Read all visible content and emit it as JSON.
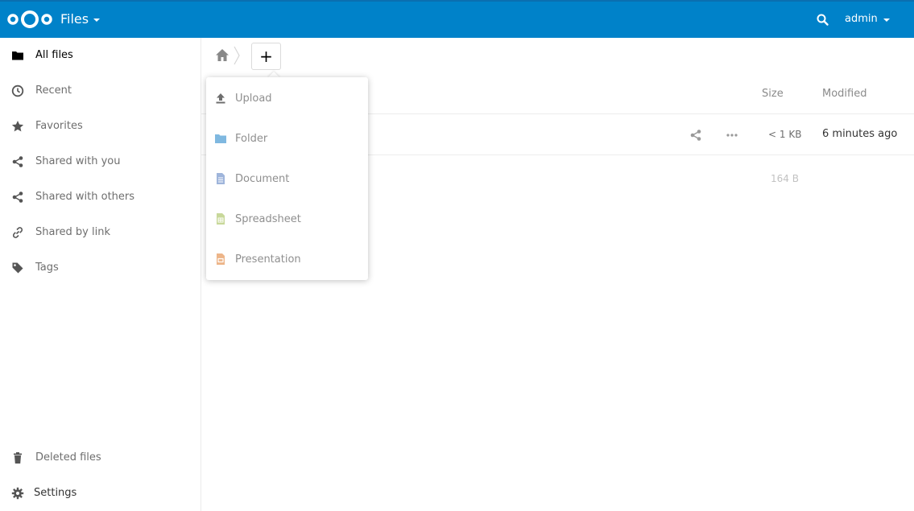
{
  "header": {
    "app_name": "Files",
    "user": "admin",
    "brand_color": "#0082c9"
  },
  "sidebar": {
    "items": [
      {
        "label": "All files",
        "icon": "folder-icon"
      },
      {
        "label": "Recent",
        "icon": "clock-icon"
      },
      {
        "label": "Favorites",
        "icon": "star-icon"
      },
      {
        "label": "Shared with you",
        "icon": "share-icon"
      },
      {
        "label": "Shared with others",
        "icon": "share-icon"
      },
      {
        "label": "Shared by link",
        "icon": "link-icon"
      },
      {
        "label": "Tags",
        "icon": "tag-icon"
      }
    ],
    "deleted_label": "Deleted files",
    "settings_label": "Settings"
  },
  "controls": {
    "new_label": "+"
  },
  "new_menu": {
    "items": [
      {
        "label": "Upload",
        "icon": "upload-icon"
      },
      {
        "label": "Folder",
        "icon": "folder-icon"
      },
      {
        "label": "Document",
        "icon": "document-icon"
      },
      {
        "label": "Spreadsheet",
        "icon": "spreadsheet-icon"
      },
      {
        "label": "Presentation",
        "icon": "presentation-icon"
      }
    ]
  },
  "file_list": {
    "columns": {
      "size": "Size",
      "modified": "Modified"
    },
    "rows": [
      {
        "size": "< 1 KB",
        "modified": "6 minutes ago"
      }
    ],
    "summary_size": "164 B"
  }
}
